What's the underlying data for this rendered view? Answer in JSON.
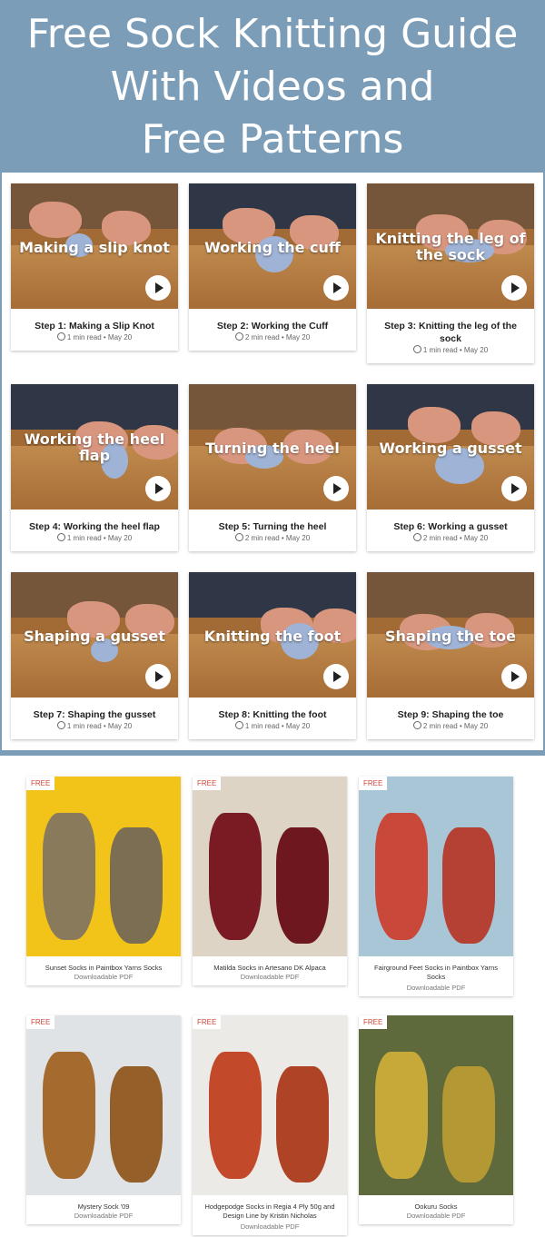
{
  "header": {
    "line1": "Free Sock Knitting Guide",
    "line2": "With Videos and",
    "line3": "Free Patterns"
  },
  "videos": [
    {
      "caption": "Making a slip knot",
      "title": "Step 1: Making a Slip Knot",
      "meta": "1 min read • May 20"
    },
    {
      "caption": "Working the cuff",
      "title": "Step 2: Working the Cuff",
      "meta": "2 min read • May 20"
    },
    {
      "caption": "Knitting the leg of the sock",
      "title": "Step 3: Knitting the leg of the sock",
      "meta": "1 min read • May 20"
    },
    {
      "caption": "Working the heel flap",
      "title": "Step 4: Working the heel flap",
      "meta": "1 min read • May 20"
    },
    {
      "caption": "Turning the heel",
      "title": "Step 5: Turning the heel",
      "meta": "2 min read • May 20"
    },
    {
      "caption": "Working a gusset",
      "title": "Step 6: Working a gusset",
      "meta": "2 min read • May 20"
    },
    {
      "caption": "Shaping a gusset",
      "title": "Step 7: Shaping the gusset",
      "meta": "1 min read • May 20"
    },
    {
      "caption": "Knitting the foot",
      "title": "Step 8: Knitting the foot",
      "meta": "1 min read • May 20"
    },
    {
      "caption": "Shaping the toe",
      "title": "Step 9: Shaping the toe",
      "meta": "2 min read • May 20"
    }
  ],
  "patterns": [
    {
      "badge": "FREE",
      "title": "Sunset Socks in Paintbox Yarns Socks",
      "sub": "Downloadable PDF",
      "bg": "#f2c419",
      "sock": "#8a7a5c"
    },
    {
      "badge": "FREE",
      "title": "Matilda Socks in Artesano DK Alpaca",
      "sub": "Downloadable PDF",
      "bg": "#ddd4c6",
      "sock": "#7a1a22"
    },
    {
      "badge": "FREE",
      "title": "Fairground Feet Socks in Paintbox Yarns Socks",
      "sub": "Downloadable PDF",
      "bg": "#a9c6d6",
      "sock": "#c9483a"
    },
    {
      "badge": "FREE",
      "title": "Mystery Sock '09",
      "sub": "Downloadable PDF",
      "bg": "#dfe3e6",
      "sock": "#a56a2e"
    },
    {
      "badge": "FREE",
      "title": "Hodgepodge Socks in Regia 4 Ply 50g and Design Line by Kristin Nicholas",
      "sub": "Downloadable PDF",
      "bg": "#eceae6",
      "sock": "#c24a2a"
    },
    {
      "badge": "FREE",
      "title": "Ookuru Socks",
      "sub": "Downloadable PDF",
      "bg": "#5e6a3c",
      "sock": "#c7a93a"
    }
  ]
}
